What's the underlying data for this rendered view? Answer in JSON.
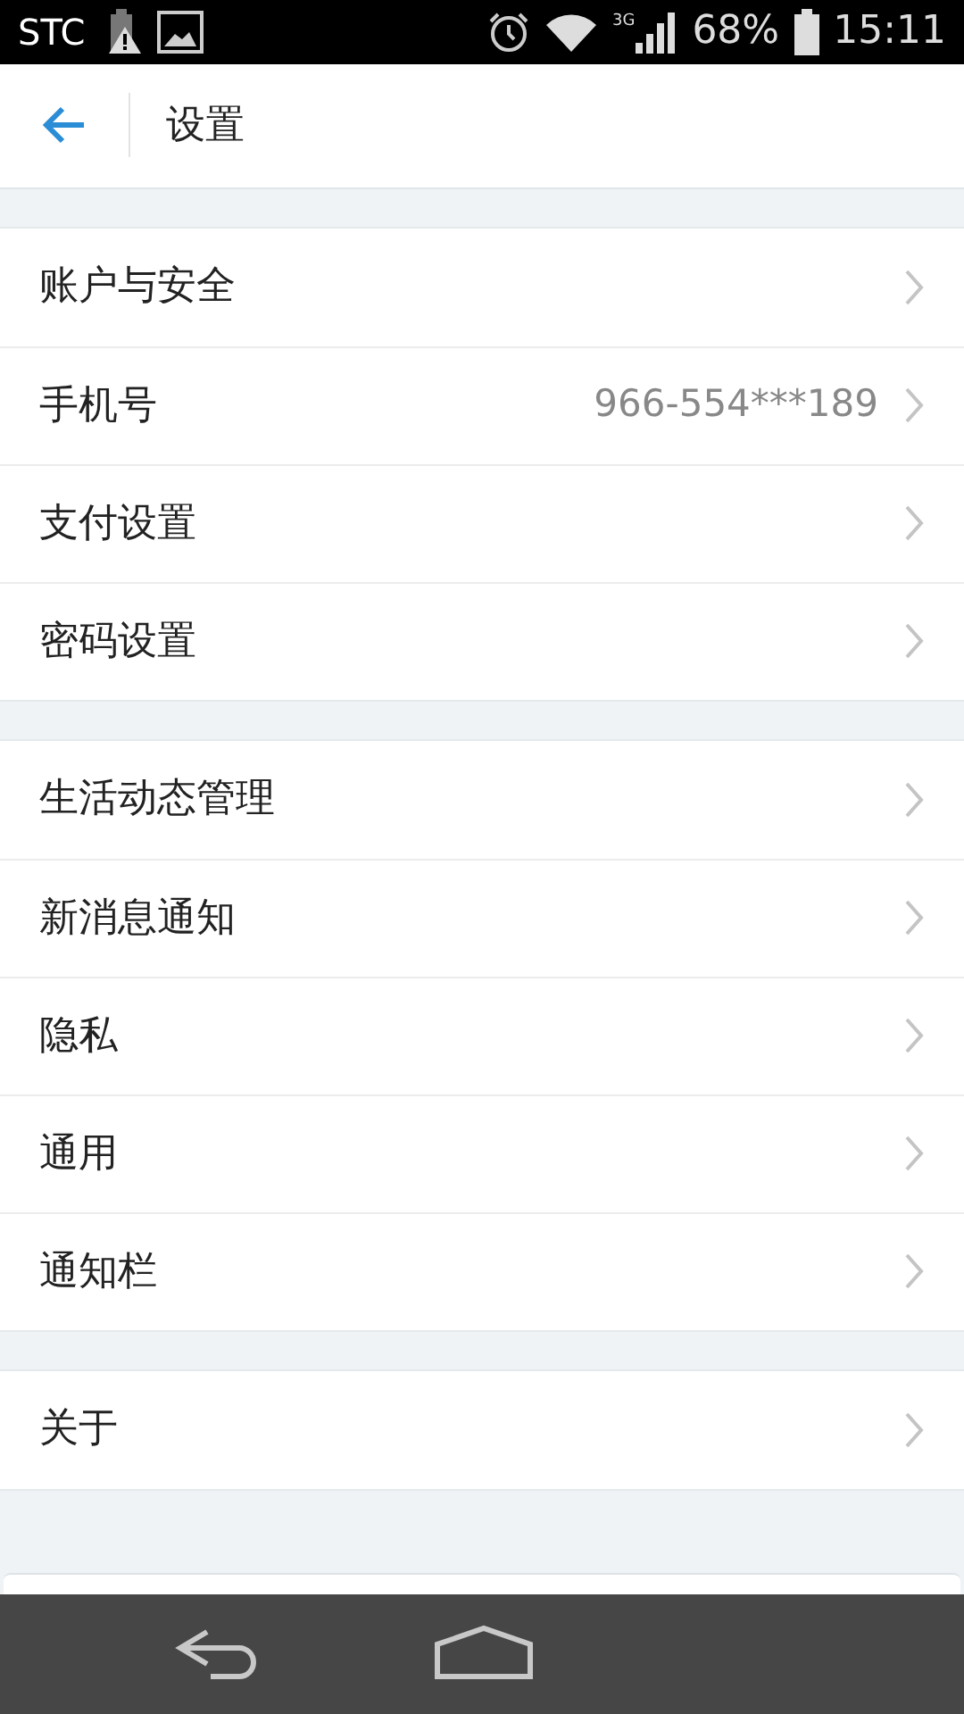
{
  "status_bar": {
    "carrier": "STC",
    "battery": "68%",
    "time": "15:11",
    "network": "3G"
  },
  "header": {
    "title": "设置"
  },
  "groups": [
    {
      "items": [
        {
          "label": "账户与安全"
        },
        {
          "label": "手机号",
          "value": "966-554***189"
        },
        {
          "label": "支付设置"
        },
        {
          "label": "密码设置"
        }
      ]
    },
    {
      "items": [
        {
          "label": "生活动态管理"
        },
        {
          "label": "新消息通知"
        },
        {
          "label": "隐私"
        },
        {
          "label": "通用"
        },
        {
          "label": "通知栏"
        }
      ]
    },
    {
      "items": [
        {
          "label": "关于"
        }
      ]
    }
  ]
}
